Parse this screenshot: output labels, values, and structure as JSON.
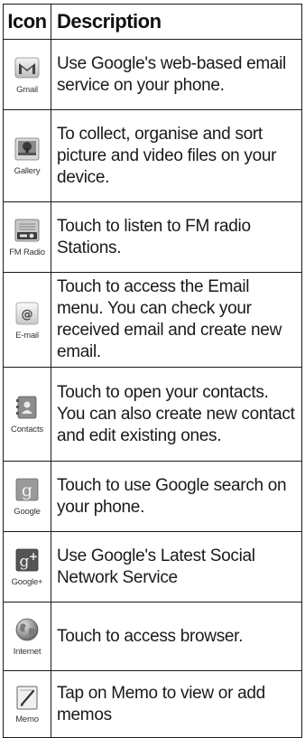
{
  "table": {
    "header": {
      "icon": "Icon",
      "description": "Description"
    },
    "rows": [
      {
        "icon_name": "gmail-icon",
        "label": "Gmail",
        "description": "Use Google's web-based email service on your phone."
      },
      {
        "icon_name": "gallery-icon",
        "label": "Gallery",
        "description": "To collect, organise and sort picture and video files on your device."
      },
      {
        "icon_name": "fm-radio-icon",
        "label": "FM Radio",
        "description": "Touch to listen to FM radio Stations."
      },
      {
        "icon_name": "email-icon",
        "label": "E-mail",
        "description": "Touch to access the Email menu. You can check your received email and create new email."
      },
      {
        "icon_name": "contacts-icon",
        "label": "Contacts",
        "description": "Touch to open your contacts. You can also create new contact and edit existing ones."
      },
      {
        "icon_name": "google-icon",
        "label": "Google",
        "description": "Touch to use Google search on your phone."
      },
      {
        "icon_name": "google-plus-icon",
        "label": "Google+",
        "description": "Use Google's Latest Social Network Service"
      },
      {
        "icon_name": "internet-icon",
        "label": "Internet",
        "description": "Touch to access browser."
      },
      {
        "icon_name": "memo-icon",
        "label": "Memo",
        "description": "Tap on Memo to view or add memos"
      }
    ]
  }
}
